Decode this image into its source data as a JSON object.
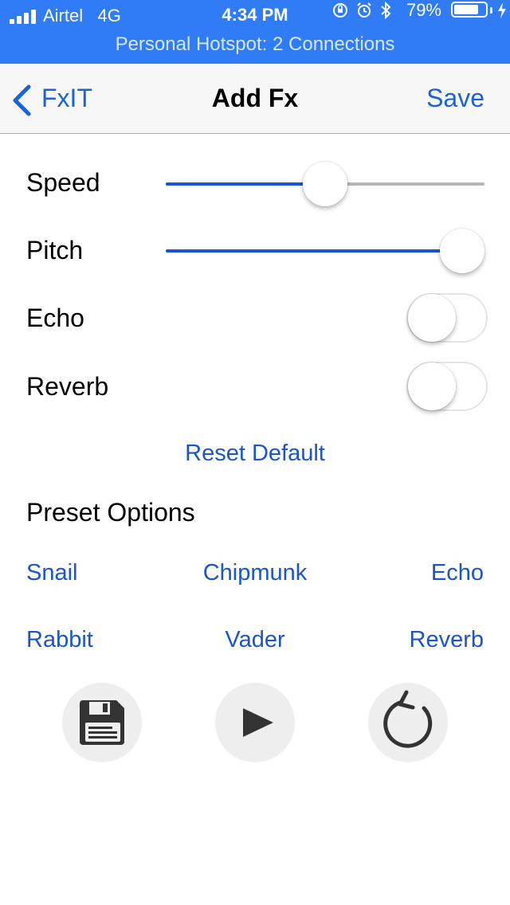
{
  "status_bar": {
    "carrier": "Airtel",
    "network": "4G",
    "time": "4:34 PM",
    "battery_percent": "79%",
    "battery_level": 0.79,
    "hotspot": "Personal Hotspot: 2 Connections",
    "color": "#2f7cf6",
    "icons": [
      "signal-icon",
      "rotation-lock-icon",
      "alarm-icon",
      "bluetooth-icon",
      "battery-icon",
      "charging-bolt-icon"
    ]
  },
  "nav": {
    "back_label": "FxIT",
    "title": "Add Fx",
    "save_label": "Save",
    "tint": "#1a63d8"
  },
  "controls": {
    "speed": {
      "label": "Speed",
      "value": 0.5
    },
    "pitch": {
      "label": "Pitch",
      "value": 0.93
    },
    "echo": {
      "label": "Echo",
      "on": false
    },
    "reverb": {
      "label": "Reverb",
      "on": false
    }
  },
  "reset_label": "Reset Default",
  "presets": {
    "title": "Preset Options",
    "items": [
      "Snail",
      "Chipmunk",
      "Echo",
      "Rabbit",
      "Vader",
      "Reverb"
    ]
  },
  "actions": {
    "save_icon": "floppy-disk-icon",
    "play_icon": "play-icon",
    "reset_icon": "rotate-ccw-icon"
  }
}
